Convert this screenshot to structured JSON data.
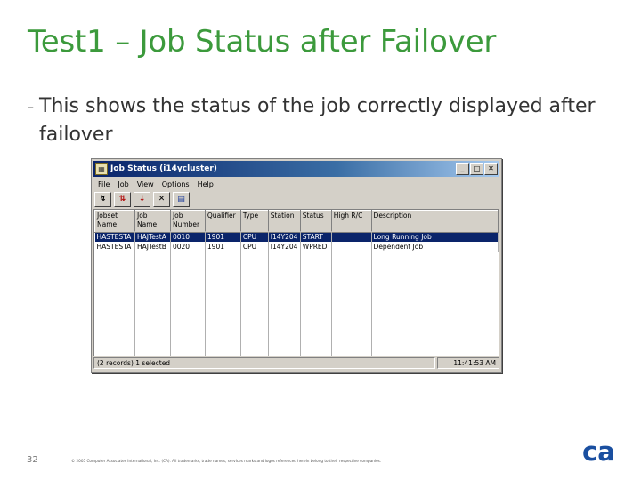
{
  "slide": {
    "title": "Test1 – Job Status after Failover",
    "bullet": "This shows the status of the job correctly displayed after failover",
    "page_number": "32",
    "copyright": "© 2005 Computer Associates International, Inc. (CA). All trademarks, trade names, services marks and logos referenced herein belong to their respective companies.",
    "logo_text": "ca"
  },
  "window": {
    "title": "Job Status (i14ycluster)",
    "controls": {
      "minimize": "_",
      "maximize": "□",
      "close": "✕"
    },
    "menu": [
      "File",
      "Job",
      "View",
      "Options",
      "Help"
    ],
    "toolbar": [
      "↯",
      "⇅",
      "↓",
      "✕",
      "▤"
    ],
    "columns": [
      "Jobset\nName",
      "Job\nName",
      "Job\nNumber",
      "Qualifier",
      "Type",
      "Station",
      "Status",
      "High R/C",
      "Description"
    ],
    "rows": [
      [
        "HASTESTA",
        "HAJTestA",
        "0010",
        "1901",
        "CPU",
        "I14Y204",
        "START",
        "",
        "Long Running Job"
      ],
      [
        "HASTESTA",
        "HAJTestB",
        "0020",
        "1901",
        "CPU",
        "I14Y204",
        "WPRED",
        "",
        "Dependent Job"
      ]
    ],
    "status": {
      "left": "(2 records) 1 selected",
      "right": "11:41:53 AM"
    }
  },
  "colors": {
    "title_green": "#3c9a3c",
    "selection": "#0a246a",
    "logo_blue": "#1a4fa0"
  }
}
